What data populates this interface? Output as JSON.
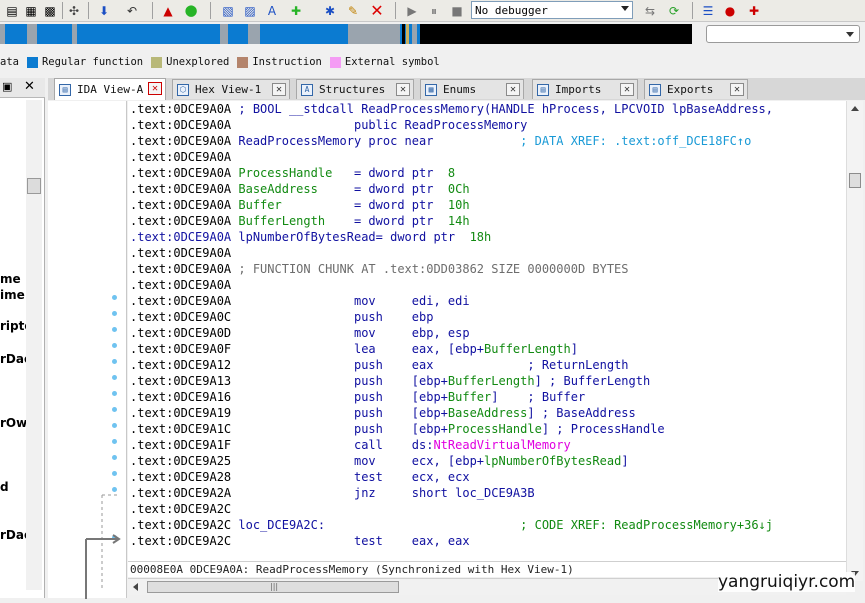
{
  "toolbar": {
    "debugger_select": "No debugger",
    "icons": [
      "functions-icon",
      "names-icon",
      "strings-icon",
      "patch-icon",
      "jump-icon",
      "back-icon",
      "warning-icon",
      "run-icon",
      "code-icon",
      "data-icon",
      "text-icon",
      "add-icon",
      "star-icon",
      "edit-icon",
      "delete-icon",
      "play-icon",
      "pause-icon",
      "stop-icon",
      "attach-icon",
      "refresh-icon",
      "list-icon",
      "breakpoint-icon",
      "watch-icon"
    ]
  },
  "colors": {
    "regular_function": "#0b7bd1",
    "unexplored": "#b8b878",
    "instruction": "#b4846c",
    "external_symbol": "#f49cf4",
    "nav_gray": "#9aa4ae",
    "nav_black": "#000000"
  },
  "legend": [
    {
      "label": "ata",
      "color": "#b7b7b7"
    },
    {
      "label": "Regular function",
      "color": "#0b7bd1"
    },
    {
      "label": "Unexplored",
      "color": "#b8b878"
    },
    {
      "label": "Instruction",
      "color": "#b4846c"
    },
    {
      "label": "External symbol",
      "color": "#f49cf4"
    }
  ],
  "left_panel": {
    "items": [
      "me",
      "ime",
      "ripto",
      "rDac",
      "rOwn",
      "d",
      "rDac"
    ]
  },
  "tabs": [
    {
      "label": "IDA View-A",
      "active": true
    },
    {
      "label": "Hex View-1",
      "active": false
    },
    {
      "label": "Structures",
      "active": false
    },
    {
      "label": "Enums",
      "active": false
    },
    {
      "label": "Imports",
      "active": false
    },
    {
      "label": "Exports",
      "active": false
    }
  ],
  "disasm": [
    {
      "addr": ".text:0DCE9A0A",
      "hl": false,
      "parts": [
        {
          "t": " ; BOOL __stdcall ReadProcessMemory(HANDLE hProcess, LPCVOID lpBaseAddress,",
          "c": "kw"
        }
      ]
    },
    {
      "addr": ".text:0DCE9A0A",
      "hl": false,
      "parts": [
        {
          "t": "                 public ReadProcessMemory",
          "c": "kw"
        }
      ]
    },
    {
      "addr": ".text:0DCE9A0A",
      "hl": false,
      "parts": [
        {
          "t": " ReadProcessMemory proc near",
          "c": "kw"
        },
        {
          "t": "            ; DATA XREF: .text:off_DCE18FC↑o",
          "c": "cmt"
        }
      ]
    },
    {
      "addr": ".text:0DCE9A0A",
      "hl": false,
      "parts": []
    },
    {
      "addr": ".text:0DCE9A0A",
      "hl": false,
      "parts": [
        {
          "t": " ProcessHandle",
          "c": "lbl"
        },
        {
          "t": "   = dword ptr  ",
          "c": "kw"
        },
        {
          "t": "8",
          "c": "lbl"
        }
      ]
    },
    {
      "addr": ".text:0DCE9A0A",
      "hl": false,
      "parts": [
        {
          "t": " BaseAddress",
          "c": "lbl"
        },
        {
          "t": "     = dword ptr  ",
          "c": "kw"
        },
        {
          "t": "0Ch",
          "c": "lbl"
        }
      ]
    },
    {
      "addr": ".text:0DCE9A0A",
      "hl": false,
      "parts": [
        {
          "t": " Buffer",
          "c": "lbl"
        },
        {
          "t": "          = dword ptr  ",
          "c": "kw"
        },
        {
          "t": "10h",
          "c": "lbl"
        }
      ]
    },
    {
      "addr": ".text:0DCE9A0A",
      "hl": false,
      "parts": [
        {
          "t": " BufferLength",
          "c": "lbl"
        },
        {
          "t": "    = dword ptr  ",
          "c": "kw"
        },
        {
          "t": "14h",
          "c": "lbl"
        }
      ]
    },
    {
      "addr": ".text:0DCE9A0A",
      "hl": true,
      "parts": [
        {
          "t": " lpNumberOfBytesRead= dword ptr  ",
          "c": "kw"
        },
        {
          "t": "18h",
          "c": "lbl"
        }
      ]
    },
    {
      "addr": ".text:0DCE9A0A",
      "hl": false,
      "parts": []
    },
    {
      "addr": ".text:0DCE9A0A",
      "hl": false,
      "parts": [
        {
          "t": " ; FUNCTION CHUNK AT .text:0DD03862 SIZE 0000000D BYTES",
          "c": "grey"
        }
      ]
    },
    {
      "addr": ".text:0DCE9A0A",
      "hl": false,
      "parts": []
    },
    {
      "addr": ".text:0DCE9A0A",
      "hl": false,
      "parts": [
        {
          "t": "                 mov     edi, edi",
          "c": "kw"
        }
      ]
    },
    {
      "addr": ".text:0DCE9A0C",
      "hl": false,
      "parts": [
        {
          "t": "                 push    ebp",
          "c": "kw"
        }
      ]
    },
    {
      "addr": ".text:0DCE9A0D",
      "hl": false,
      "parts": [
        {
          "t": "                 mov     ebp, esp",
          "c": "kw"
        }
      ]
    },
    {
      "addr": ".text:0DCE9A0F",
      "hl": false,
      "parts": [
        {
          "t": "                 lea     eax, [ebp+",
          "c": "kw"
        },
        {
          "t": "BufferLength",
          "c": "lbl"
        },
        {
          "t": "]",
          "c": "kw"
        }
      ]
    },
    {
      "addr": ".text:0DCE9A12",
      "hl": false,
      "parts": [
        {
          "t": "                 push    eax",
          "c": "kw"
        },
        {
          "t": "             ; ReturnLength",
          "c": "kw"
        }
      ]
    },
    {
      "addr": ".text:0DCE9A13",
      "hl": false,
      "parts": [
        {
          "t": "                 push    [ebp+",
          "c": "kw"
        },
        {
          "t": "BufferLength",
          "c": "lbl"
        },
        {
          "t": "] ; BufferLength",
          "c": "kw"
        }
      ]
    },
    {
      "addr": ".text:0DCE9A16",
      "hl": false,
      "parts": [
        {
          "t": "                 push    [ebp+",
          "c": "kw"
        },
        {
          "t": "Buffer",
          "c": "lbl"
        },
        {
          "t": "]    ; Buffer",
          "c": "kw"
        }
      ]
    },
    {
      "addr": ".text:0DCE9A19",
      "hl": false,
      "parts": [
        {
          "t": "                 push    [ebp+",
          "c": "kw"
        },
        {
          "t": "BaseAddress",
          "c": "lbl"
        },
        {
          "t": "] ; BaseAddress",
          "c": "kw"
        }
      ]
    },
    {
      "addr": ".text:0DCE9A1C",
      "hl": false,
      "parts": [
        {
          "t": "                 push    [ebp+",
          "c": "kw"
        },
        {
          "t": "ProcessHandle",
          "c": "lbl"
        },
        {
          "t": "] ; ProcessHandle",
          "c": "kw"
        }
      ]
    },
    {
      "addr": ".text:0DCE9A1F",
      "hl": false,
      "parts": [
        {
          "t": "                 call    ds:",
          "c": "kw"
        },
        {
          "t": "NtReadVirtualMemory",
          "c": "mag"
        }
      ]
    },
    {
      "addr": ".text:0DCE9A25",
      "hl": false,
      "parts": [
        {
          "t": "                 mov     ecx, [ebp+",
          "c": "kw"
        },
        {
          "t": "lpNumberOfBytesRead",
          "c": "lbl"
        },
        {
          "t": "]",
          "c": "kw"
        }
      ]
    },
    {
      "addr": ".text:0DCE9A28",
      "hl": false,
      "parts": [
        {
          "t": "                 test    ecx, ecx",
          "c": "kw"
        }
      ]
    },
    {
      "addr": ".text:0DCE9A2A",
      "hl": false,
      "parts": [
        {
          "t": "                 jnz     short loc_DCE9A3B",
          "c": "kw"
        }
      ]
    },
    {
      "addr": ".text:0DCE9A2C",
      "hl": false,
      "parts": []
    },
    {
      "addr": ".text:0DCE9A2C",
      "hl": false,
      "parts": [
        {
          "t": " loc_DCE9A2C:",
          "c": "kw"
        },
        {
          "t": "                           ; CODE XREF: ReadProcessMemory+36↓j",
          "c": "lbl"
        }
      ]
    },
    {
      "addr": ".text:0DCE9A2C",
      "hl": false,
      "parts": [
        {
          "t": "                 test    eax, eax",
          "c": "kw"
        }
      ]
    }
  ],
  "status_line": "00008E0A 0DCE9A0A: ReadProcessMemory (Synchronized with Hex View-1)",
  "watermark": "yangruiqiyr.com"
}
